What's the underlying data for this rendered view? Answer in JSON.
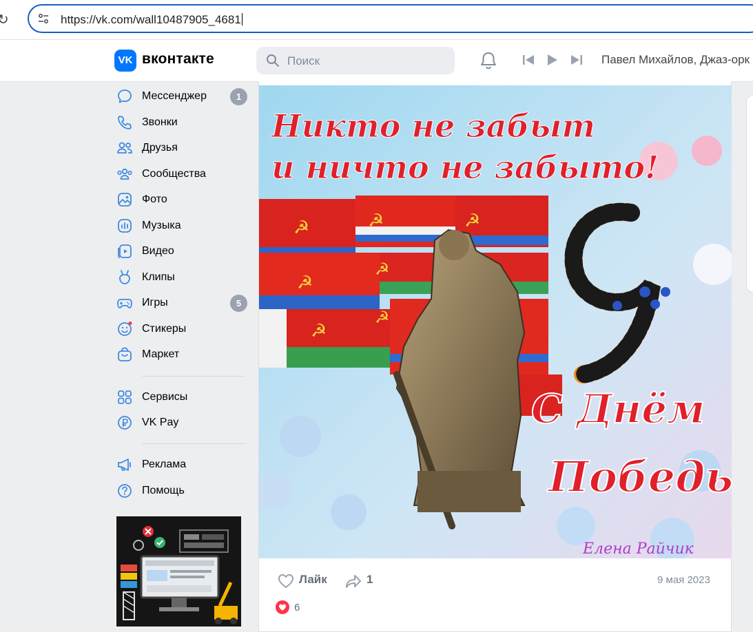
{
  "browser": {
    "url": "https://vk.com/wall10487905_4681"
  },
  "header": {
    "logo_mark": "VK",
    "logo_text": "вконтакте",
    "search_placeholder": "Поиск",
    "now_playing": "Павел Михайлов, Джаз-орк"
  },
  "sidebar": {
    "items": [
      {
        "label": "Мессенджер",
        "icon": "message-bubble-icon",
        "badge": "1"
      },
      {
        "label": "Звонки",
        "icon": "phone-icon"
      },
      {
        "label": "Друзья",
        "icon": "friends-icon"
      },
      {
        "label": "Сообщества",
        "icon": "communities-icon"
      },
      {
        "label": "Фото",
        "icon": "photo-icon"
      },
      {
        "label": "Музыка",
        "icon": "music-icon"
      },
      {
        "label": "Видео",
        "icon": "video-icon"
      },
      {
        "label": "Клипы",
        "icon": "clips-icon"
      },
      {
        "label": "Игры",
        "icon": "gamepad-icon",
        "badge": "5"
      },
      {
        "label": "Стикеры",
        "icon": "sticker-icon"
      },
      {
        "label": "Маркет",
        "icon": "market-bag-icon"
      }
    ],
    "items2": [
      {
        "label": "Сервисы",
        "icon": "services-grid-icon"
      },
      {
        "label": "VK Pay",
        "icon": "ruble-icon"
      }
    ],
    "items3": [
      {
        "label": "Реклама",
        "icon": "megaphone-icon"
      },
      {
        "label": "Помощь",
        "icon": "help-icon"
      }
    ]
  },
  "post": {
    "image": {
      "heading_line1": "Никто не забыт",
      "heading_line2": "и ничто не забыто!",
      "number": "9",
      "greeting_line1": "С Днём",
      "greeting_line2": "Победы!",
      "signature": "Елена Райчик"
    },
    "like_label": "Лайк",
    "share_count": "1",
    "date": "9 мая 2023",
    "likes_count": "6"
  },
  "colors": {
    "accent": "#0077ff",
    "url_border": "#1a5cc8",
    "badge": "#99a2ad",
    "like_heart": "#ff3347"
  }
}
